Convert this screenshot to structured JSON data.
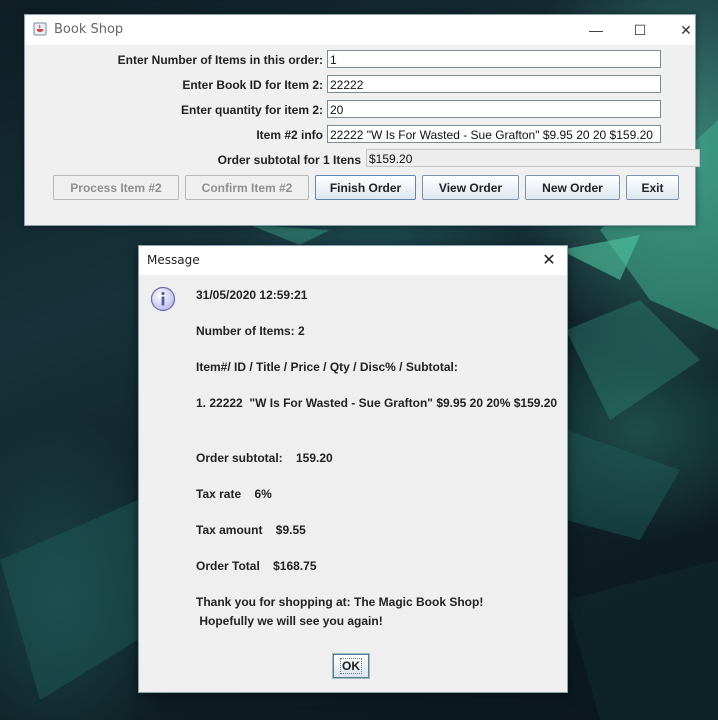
{
  "main_window": {
    "title": "Book Shop",
    "controls": {
      "minimize": "—",
      "maximize": "☐",
      "close": "✕"
    },
    "rows": [
      {
        "label": "Enter Number of Items in this order:",
        "value": "1"
      },
      {
        "label": "Enter Book ID for Item 2:",
        "value": "22222"
      },
      {
        "label": "Enter quantity for item 2:",
        "value": "20"
      },
      {
        "label": "Item #2 info",
        "value": "22222  \"W Is For Wasted - Sue Grafton\" $9.95 20 20 $159.20"
      },
      {
        "label": "Order subtotal for 1 Itens",
        "value": "$159.20"
      }
    ],
    "buttons": {
      "process": "Process Item #2",
      "confirm": "Confirm Item #2",
      "finish": "Finish Order",
      "view": "View Order",
      "new": "New Order",
      "exit": "Exit"
    }
  },
  "message_dialog": {
    "title": "Message",
    "close": "✕",
    "icon": "info-icon",
    "lines": {
      "datetime": "31/05/2020 12:59:21",
      "num_items": "Number of Items: 2",
      "header": "Item#/ ID / Title / Price / Qty / Disc% / Subtotal:",
      "item1": "1. 22222  \"W Is For Wasted - Sue Grafton\" $9.95 20 20% $159.20",
      "subtotal": "Order subtotal:    159.20",
      "tax_rate": "Tax rate    6%",
      "tax_amount": "Tax amount    $9.55",
      "total": "Order Total    $168.75",
      "thanks1": "Thank you for shopping at: The Magic Book Shop!",
      "thanks2": " Hopefully we will see you again!"
    },
    "ok": "OK"
  }
}
